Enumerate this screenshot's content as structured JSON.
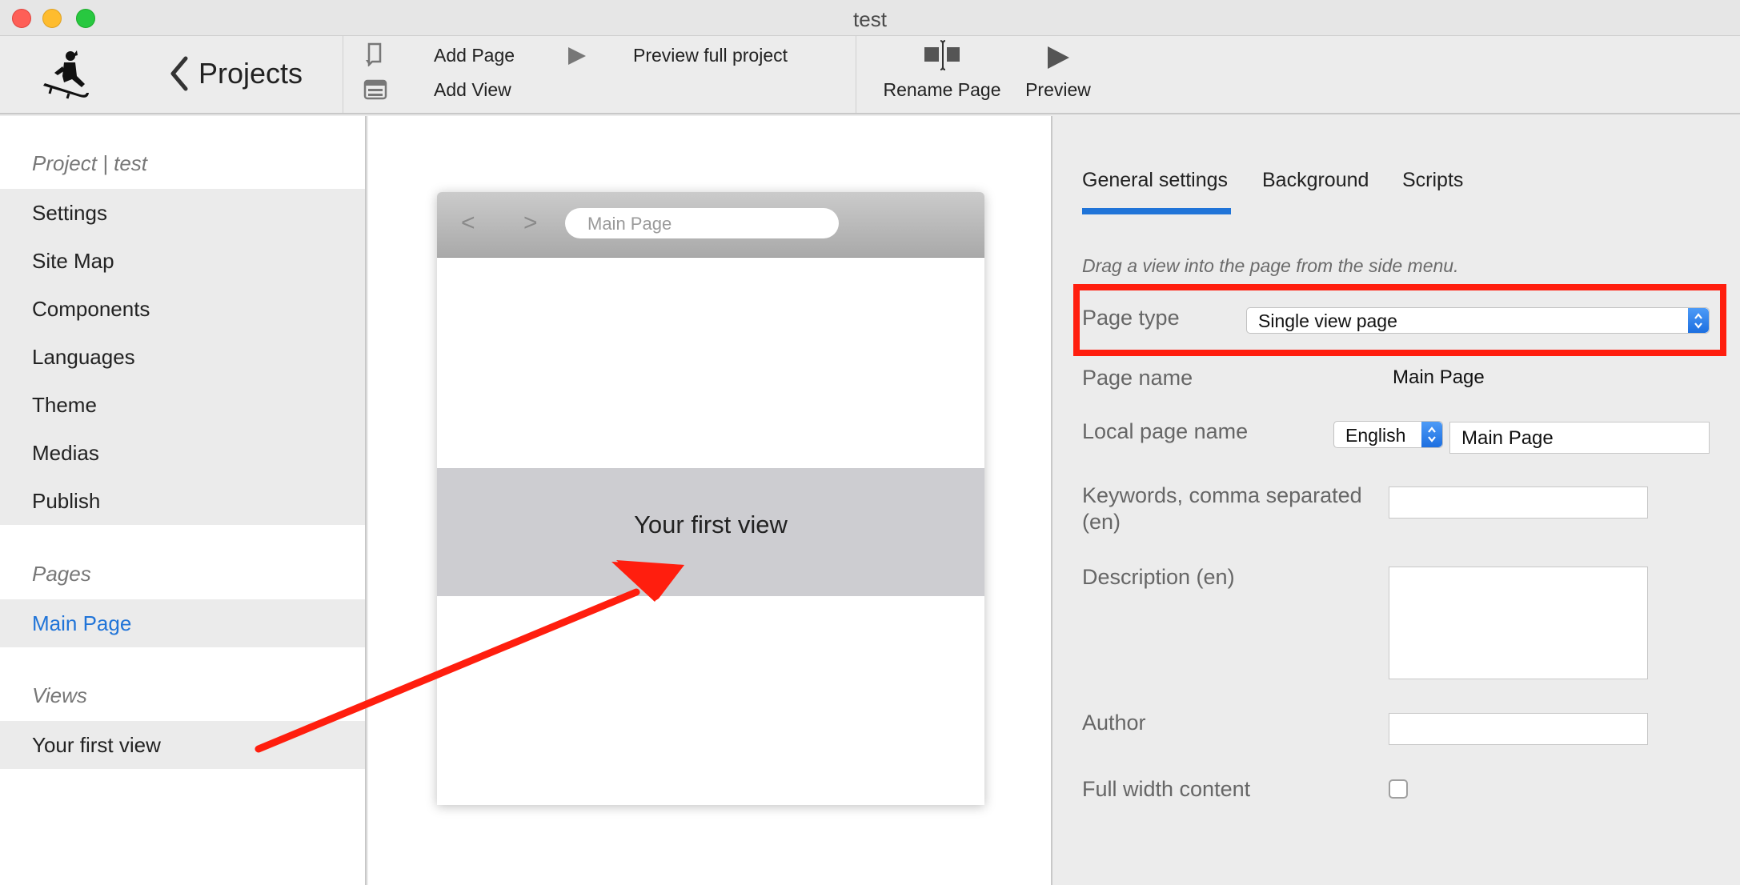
{
  "window": {
    "title": "test"
  },
  "toolbar": {
    "back_label": "Projects",
    "add_page": "Add Page",
    "add_view": "Add View",
    "preview_full_project": "Preview full project",
    "rename_page": "Rename Page",
    "preview": "Preview"
  },
  "sidebar": {
    "project_heading": "Project | test",
    "project_items": [
      {
        "label": "Settings"
      },
      {
        "label": "Site Map"
      },
      {
        "label": "Components"
      },
      {
        "label": "Languages"
      },
      {
        "label": "Theme"
      },
      {
        "label": "Medias"
      },
      {
        "label": "Publish"
      }
    ],
    "pages_heading": "Pages",
    "pages": [
      {
        "label": "Main Page",
        "selected": true
      }
    ],
    "views_heading": "Views",
    "views": [
      {
        "label": "Your first view"
      }
    ]
  },
  "canvas": {
    "nav_back": "<",
    "nav_forward": ">",
    "url_text": "Main Page",
    "view_label": "Your first view"
  },
  "panel": {
    "tabs": [
      {
        "label": "General settings",
        "active": true
      },
      {
        "label": "Background"
      },
      {
        "label": "Scripts"
      }
    ],
    "hint": "Drag a view into the page from the side menu.",
    "page_type_label": "Page type",
    "page_type_value": "Single view page",
    "page_name_label": "Page name",
    "page_name_value": "Main Page",
    "local_page_name_label": "Local page name",
    "language_value": "English",
    "local_page_name_value": "Main Page",
    "keywords_label": "Keywords, comma separated (en)",
    "keywords_value": "",
    "description_label": "Description (en)",
    "description_value": "",
    "author_label": "Author",
    "author_value": "",
    "full_width_label": "Full width content",
    "full_width_checked": false
  },
  "colors": {
    "accent": "#2074d8",
    "annotation": "#ff1e0e"
  }
}
